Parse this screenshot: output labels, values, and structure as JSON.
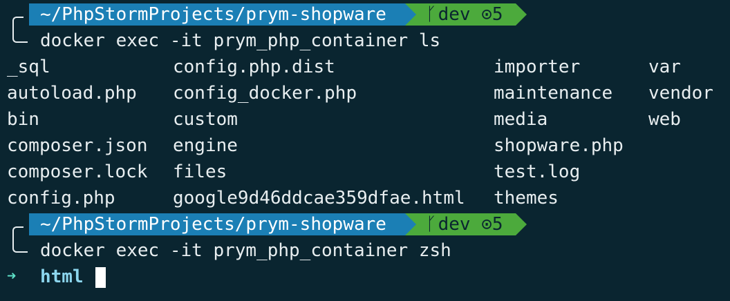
{
  "prompts": [
    {
      "path": "~/PhpStormProjects/prym-shopware",
      "branch_icon": "git-branch-icon",
      "branch_glyph": "ᚴ",
      "branch": "dev",
      "status_glyph": "⊙",
      "status_count": "5",
      "command": "docker exec -it prym_php_container ls"
    },
    {
      "path": "~/PhpStormProjects/prym-shopware",
      "branch_icon": "git-branch-icon",
      "branch_glyph": "ᚴ",
      "branch": "dev",
      "status_glyph": "⊙",
      "status_count": "5",
      "command": "docker exec -it prym_php_container zsh"
    }
  ],
  "ls_output": {
    "columns": [
      [
        "_sql",
        "autoload.php",
        "bin",
        "composer.json",
        "composer.lock",
        "config.php"
      ],
      [
        "config.php.dist",
        "config_docker.php",
        "custom",
        "engine",
        "files",
        "google9d46ddcae359dfae.html"
      ],
      [
        "importer",
        "maintenance",
        "media",
        "shopware.php",
        "test.log",
        "themes"
      ],
      [
        "var",
        "vendor",
        "web"
      ]
    ]
  },
  "final_prompt": {
    "arrow": "➜",
    "dir": "html"
  },
  "colors": {
    "background": "#0a2530",
    "path_segment": "#1b7fb5",
    "git_segment": "#4caa3c",
    "text": "#e8eef0",
    "arrow": "#5ee1c8",
    "dir": "#8cd6ee"
  }
}
